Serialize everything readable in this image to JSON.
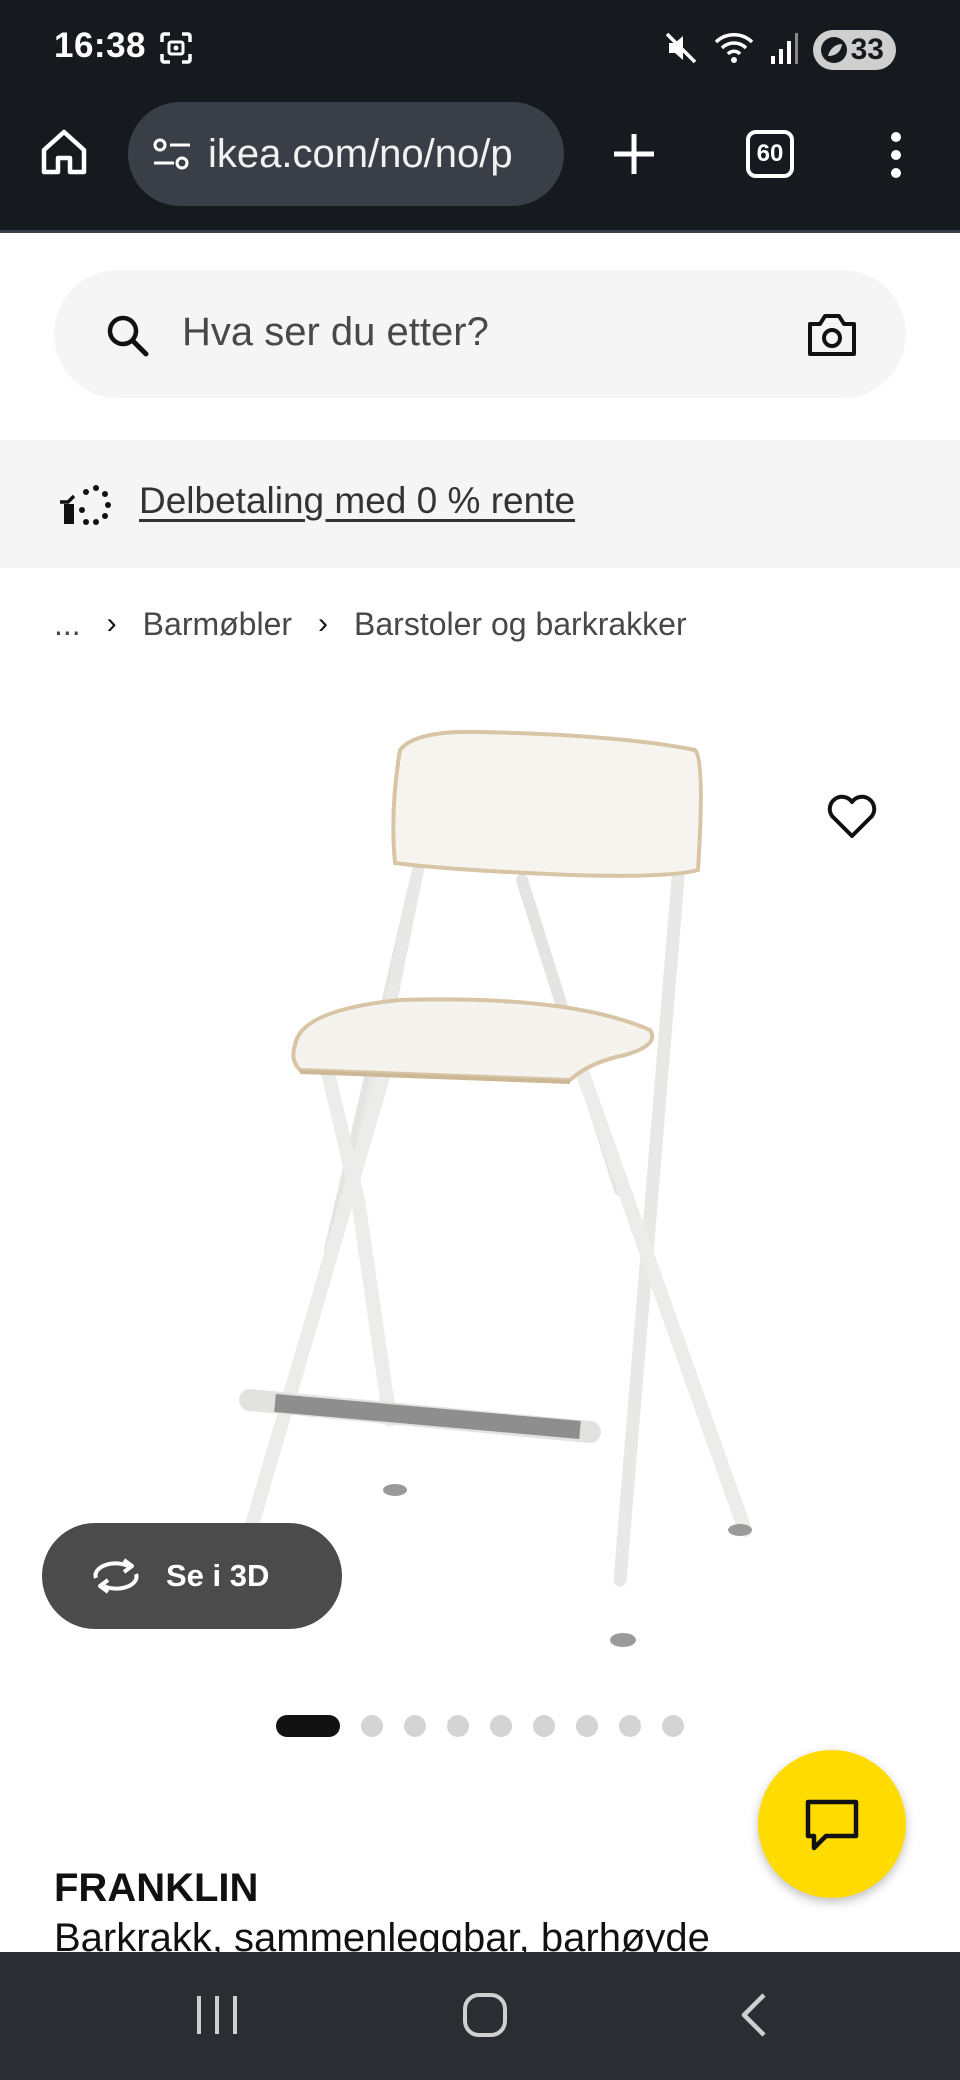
{
  "status_bar": {
    "time": "16:38",
    "battery": "33",
    "icons": [
      "screenshot-icon",
      "mute-icon",
      "wifi-icon",
      "signal-icon",
      "battery-icon"
    ]
  },
  "browser": {
    "url": "ikea.com/no/no/p",
    "tab_count": "60",
    "icons": [
      "home-icon",
      "site-settings-icon",
      "new-tab-icon",
      "tab-switcher-icon",
      "more-icon"
    ]
  },
  "search": {
    "placeholder": "Hva ser du etter?"
  },
  "promo": {
    "label": "Delbetaling med 0 % rente"
  },
  "breadcrumb": {
    "items": [
      "...",
      "Barmøbler",
      "Barstoler og barkrakker"
    ]
  },
  "product": {
    "name": "FRANKLIN",
    "description": "Barkrakk, sammenleggbar, barhøyde",
    "view_3d_label": "Se i 3D",
    "image_count": 9,
    "active_image": 1
  },
  "colors": {
    "ikea_yellow": "#ffdb00",
    "dark_chrome": "#161a1f",
    "pill_gray": "#4b4b4b"
  }
}
